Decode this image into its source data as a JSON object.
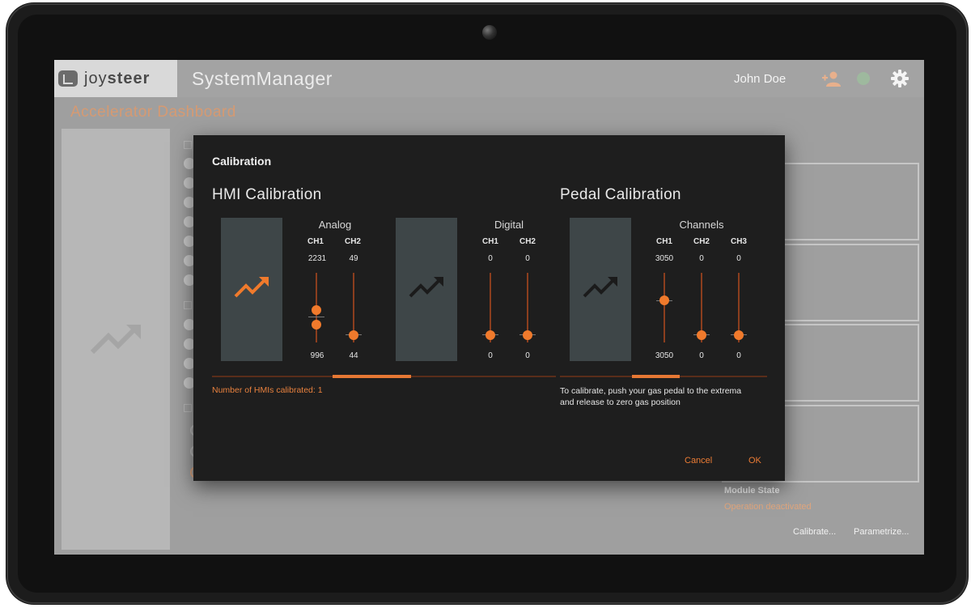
{
  "app": {
    "logo_text_light": "joy",
    "logo_text_bold": "steer",
    "title": "SystemManager",
    "user_name": "John Doe",
    "page_title": "Accelerator Dashboard"
  },
  "background": {
    "module_state_label": "Module State",
    "module_state_value": "Operation deactivated",
    "calibrate_link": "Calibrate...",
    "parametrize_link": "Parametrize..."
  },
  "dialog": {
    "title": "Calibration",
    "hmi": {
      "section_title": "HMI Calibration",
      "analog": {
        "title": "Analog",
        "channels": [
          {
            "label": "CH1",
            "max": "2231",
            "min": "996"
          },
          {
            "label": "CH2",
            "max": "49",
            "min": "44"
          }
        ]
      },
      "digital": {
        "title": "Digital",
        "channels": [
          {
            "label": "CH1",
            "max": "0",
            "min": "0"
          },
          {
            "label": "CH2",
            "max": "0",
            "min": "0"
          }
        ]
      },
      "progress_fraction": 0.35,
      "note": "Number of HMIs calibrated: 1"
    },
    "pedal": {
      "section_title": "Pedal Calibration",
      "channels_title": "Channels",
      "channels": [
        {
          "label": "CH1",
          "max": "3050",
          "min": "3050"
        },
        {
          "label": "CH2",
          "max": "0",
          "min": "0"
        },
        {
          "label": "CH3",
          "max": "0",
          "min": "0"
        }
      ],
      "progress_fraction": 0.23,
      "note_line1": "To calibrate, push your gas pedal to the extrema",
      "note_line2": "and release to zero gas position"
    },
    "cancel_label": "Cancel",
    "ok_label": "OK"
  },
  "colors": {
    "accent": "#f07a2c",
    "dialog_bg": "#1e1e1e",
    "card_bg": "#3e4648",
    "page_title": "#d69a72"
  },
  "icons": [
    "user-add-icon",
    "gear-icon",
    "trending-up-icon",
    "status-dot"
  ]
}
